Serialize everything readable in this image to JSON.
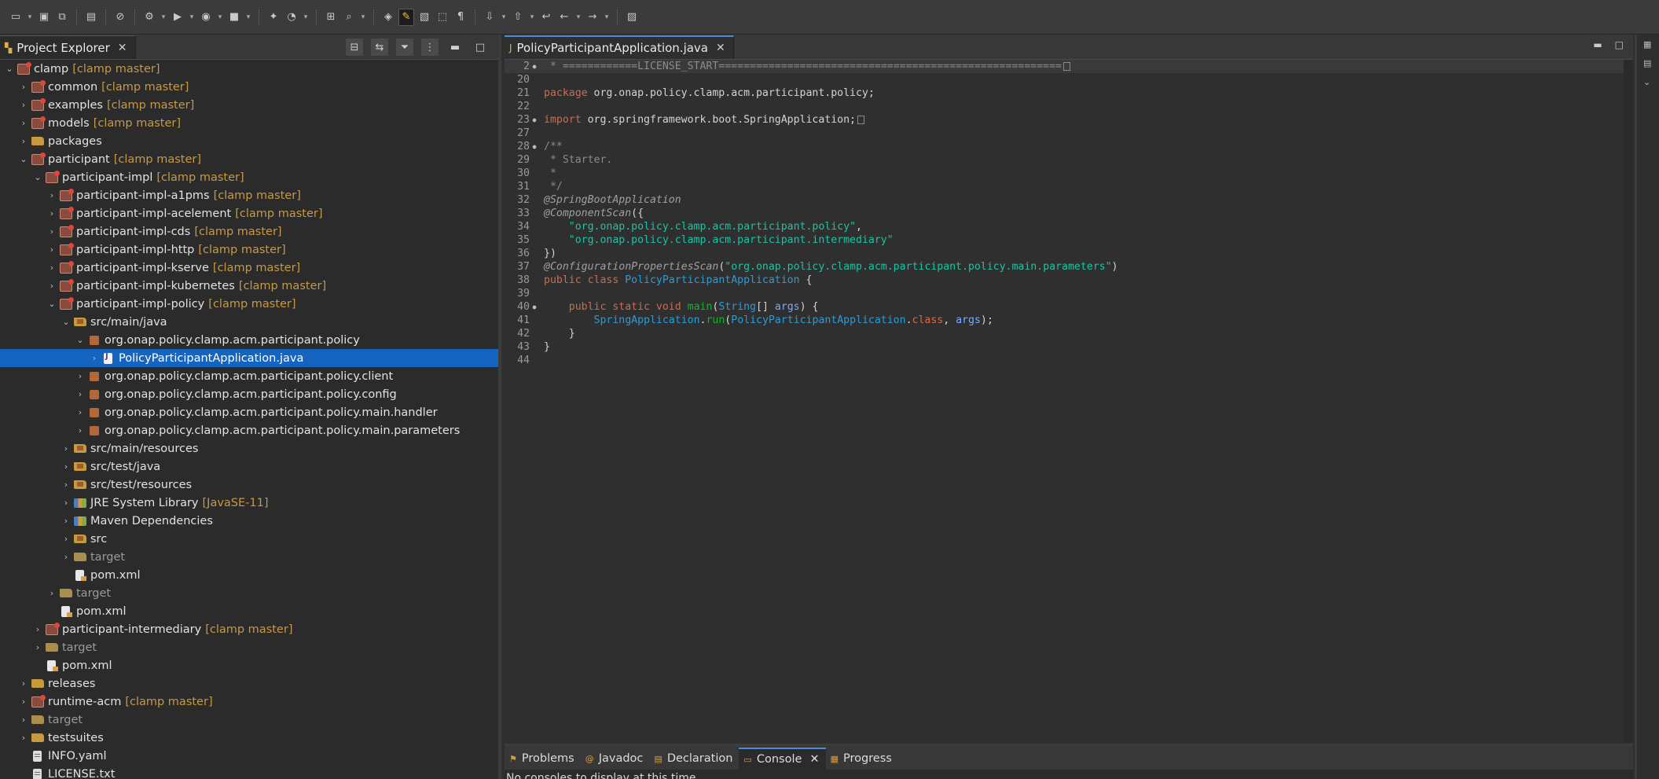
{
  "explorer": {
    "tab_label": "Project Explorer",
    "close_glyph": "✕",
    "tree": [
      {
        "indent": 0,
        "chev": "v",
        "icon": "project",
        "name": "clamp",
        "deco": "[clamp master]"
      },
      {
        "indent": 1,
        "chev": ">",
        "icon": "project",
        "name": "common",
        "deco": "[clamp master]"
      },
      {
        "indent": 1,
        "chev": ">",
        "icon": "project",
        "name": "examples",
        "deco": "[clamp master]"
      },
      {
        "indent": 1,
        "chev": ">",
        "icon": "project",
        "name": "models",
        "deco": "[clamp master]"
      },
      {
        "indent": 1,
        "chev": ">",
        "icon": "folder",
        "name": "packages",
        "deco": ""
      },
      {
        "indent": 1,
        "chev": "v",
        "icon": "project",
        "name": "participant",
        "deco": "[clamp master]"
      },
      {
        "indent": 2,
        "chev": "v",
        "icon": "project",
        "name": "participant-impl",
        "deco": "[clamp master]"
      },
      {
        "indent": 3,
        "chev": ">",
        "icon": "project",
        "name": "participant-impl-a1pms",
        "deco": "[clamp master]"
      },
      {
        "indent": 3,
        "chev": ">",
        "icon": "project",
        "name": "participant-impl-acelement",
        "deco": "[clamp master]"
      },
      {
        "indent": 3,
        "chev": ">",
        "icon": "project",
        "name": "participant-impl-cds",
        "deco": "[clamp master]"
      },
      {
        "indent": 3,
        "chev": ">",
        "icon": "project",
        "name": "participant-impl-http",
        "deco": "[clamp master]"
      },
      {
        "indent": 3,
        "chev": ">",
        "icon": "project",
        "name": "participant-impl-kserve",
        "deco": "[clamp master]"
      },
      {
        "indent": 3,
        "chev": ">",
        "icon": "project",
        "name": "participant-impl-kubernetes",
        "deco": "[clamp master]"
      },
      {
        "indent": 3,
        "chev": "v",
        "icon": "project",
        "name": "participant-impl-policy",
        "deco": "[clamp master]"
      },
      {
        "indent": 4,
        "chev": "v",
        "icon": "folder-src",
        "name": "src/main/java",
        "deco": ""
      },
      {
        "indent": 5,
        "chev": "v",
        "icon": "package",
        "name": "org.onap.policy.clamp.acm.participant.policy",
        "deco": ""
      },
      {
        "indent": 6,
        "chev": ">",
        "icon": "java",
        "name": "PolicyParticipantApplication.java",
        "deco": "",
        "selected": true
      },
      {
        "indent": 5,
        "chev": ">",
        "icon": "package",
        "name": "org.onap.policy.clamp.acm.participant.policy.client",
        "deco": ""
      },
      {
        "indent": 5,
        "chev": ">",
        "icon": "package",
        "name": "org.onap.policy.clamp.acm.participant.policy.config",
        "deco": ""
      },
      {
        "indent": 5,
        "chev": ">",
        "icon": "package",
        "name": "org.onap.policy.clamp.acm.participant.policy.main.handler",
        "deco": ""
      },
      {
        "indent": 5,
        "chev": ">",
        "icon": "package",
        "name": "org.onap.policy.clamp.acm.participant.policy.main.parameters",
        "deco": ""
      },
      {
        "indent": 4,
        "chev": ">",
        "icon": "folder-src",
        "name": "src/main/resources",
        "deco": ""
      },
      {
        "indent": 4,
        "chev": ">",
        "icon": "folder-src",
        "name": "src/test/java",
        "deco": ""
      },
      {
        "indent": 4,
        "chev": ">",
        "icon": "folder-src",
        "name": "src/test/resources",
        "deco": ""
      },
      {
        "indent": 4,
        "chev": ">",
        "icon": "lib",
        "name": "JRE System Library",
        "deco": "[JavaSE-11]"
      },
      {
        "indent": 4,
        "chev": ">",
        "icon": "lib",
        "name": "Maven Dependencies",
        "deco": ""
      },
      {
        "indent": 4,
        "chev": ">",
        "icon": "folder-src",
        "name": "src",
        "deco": ""
      },
      {
        "indent": 4,
        "chev": ">",
        "icon": "folder-target",
        "name": "target",
        "deco": "",
        "muted": true
      },
      {
        "indent": 4,
        "chev": "",
        "icon": "xml",
        "name": "pom.xml",
        "deco": ""
      },
      {
        "indent": 3,
        "chev": ">",
        "icon": "folder-target",
        "name": "target",
        "deco": "",
        "muted": true
      },
      {
        "indent": 3,
        "chev": "",
        "icon": "xml",
        "name": "pom.xml",
        "deco": ""
      },
      {
        "indent": 2,
        "chev": ">",
        "icon": "project",
        "name": "participant-intermediary",
        "deco": "[clamp master]"
      },
      {
        "indent": 2,
        "chev": ">",
        "icon": "folder-target",
        "name": "target",
        "deco": "",
        "muted": true
      },
      {
        "indent": 2,
        "chev": "",
        "icon": "xml",
        "name": "pom.xml",
        "deco": ""
      },
      {
        "indent": 1,
        "chev": ">",
        "icon": "folder",
        "name": "releases",
        "deco": ""
      },
      {
        "indent": 1,
        "chev": ">",
        "icon": "project",
        "name": "runtime-acm",
        "deco": "[clamp master]"
      },
      {
        "indent": 1,
        "chev": ">",
        "icon": "folder-target",
        "name": "target",
        "deco": "",
        "muted": true
      },
      {
        "indent": 1,
        "chev": ">",
        "icon": "folder",
        "name": "testsuites",
        "deco": ""
      },
      {
        "indent": 1,
        "chev": "",
        "icon": "file",
        "name": "INFO.yaml",
        "deco": ""
      },
      {
        "indent": 1,
        "chev": "",
        "icon": "file",
        "name": "LICENSE.txt",
        "deco": ""
      }
    ]
  },
  "editor": {
    "tab_label": "PolicyParticipantApplication.java",
    "close_glyph": "✕",
    "lines": [
      {
        "n": "2",
        "fold": "+",
        "first": true,
        "parts": [
          [
            "cmt",
            " * ============LICENSE_START======================================================="
          ],
          [
            "box",
            ""
          ]
        ]
      },
      {
        "n": "20",
        "parts": []
      },
      {
        "n": "21",
        "parts": [
          [
            "kw",
            "package"
          ],
          [
            "tx",
            " org.onap.policy.clamp.acm.participant.policy;"
          ]
        ]
      },
      {
        "n": "22",
        "parts": []
      },
      {
        "n": "23",
        "fold": "+",
        "parts": [
          [
            "kw",
            "import"
          ],
          [
            "tx",
            " org.springframework.boot.SpringApplication;"
          ],
          [
            "box",
            ""
          ]
        ]
      },
      {
        "n": "27",
        "parts": []
      },
      {
        "n": "28",
        "fold": "-",
        "parts": [
          [
            "cmt",
            "/**"
          ]
        ]
      },
      {
        "n": "29",
        "parts": [
          [
            "cmt",
            " * Starter."
          ]
        ]
      },
      {
        "n": "30",
        "parts": [
          [
            "cmt",
            " *"
          ]
        ]
      },
      {
        "n": "31",
        "parts": [
          [
            "cmt",
            " */"
          ]
        ]
      },
      {
        "n": "32",
        "parts": [
          [
            "ann",
            "@SpringBootApplication"
          ]
        ]
      },
      {
        "n": "33",
        "parts": [
          [
            "ann",
            "@ComponentScan"
          ],
          [
            "tx",
            "({"
          ]
        ]
      },
      {
        "n": "34",
        "parts": [
          [
            "tx",
            "    "
          ],
          [
            "str",
            "\"org.onap.policy.clamp.acm.participant.policy\""
          ],
          [
            "tx",
            ","
          ]
        ]
      },
      {
        "n": "35",
        "parts": [
          [
            "tx",
            "    "
          ],
          [
            "str",
            "\"org.onap.policy.clamp.acm.participant.intermediary\""
          ]
        ]
      },
      {
        "n": "36",
        "parts": [
          [
            "tx",
            "})"
          ]
        ]
      },
      {
        "n": "37",
        "parts": [
          [
            "ann",
            "@ConfigurationPropertiesScan"
          ],
          [
            "tx",
            "("
          ],
          [
            "str",
            "\"org.onap.policy.clamp.acm.participant.policy.main.parameters\""
          ],
          [
            "tx",
            ")"
          ]
        ]
      },
      {
        "n": "38",
        "parts": [
          [
            "kw",
            "public class"
          ],
          [
            "tx",
            " "
          ],
          [
            "cls",
            "PolicyParticipantApplication"
          ],
          [
            "tx",
            " {"
          ]
        ]
      },
      {
        "n": "39",
        "parts": []
      },
      {
        "n": "40",
        "fold": "-",
        "parts": [
          [
            "tx",
            "    "
          ],
          [
            "kw",
            "public static void"
          ],
          [
            "tx",
            " "
          ],
          [
            "mth",
            "main"
          ],
          [
            "tx",
            "("
          ],
          [
            "cls",
            "String"
          ],
          [
            "tx",
            "[] "
          ],
          [
            "var",
            "args"
          ],
          [
            "tx",
            ") {"
          ]
        ]
      },
      {
        "n": "41",
        "parts": [
          [
            "tx",
            "        "
          ],
          [
            "cls",
            "SpringApplication"
          ],
          [
            "tx",
            "."
          ],
          [
            "mth",
            "run"
          ],
          [
            "tx",
            "("
          ],
          [
            "cls",
            "PolicyParticipantApplication"
          ],
          [
            "tx",
            "."
          ],
          [
            "kw",
            "class"
          ],
          [
            "tx",
            ", "
          ],
          [
            "var",
            "args"
          ],
          [
            "tx",
            ");"
          ]
        ]
      },
      {
        "n": "42",
        "parts": [
          [
            "tx",
            "    }"
          ]
        ]
      },
      {
        "n": "43",
        "parts": [
          [
            "tx",
            "}"
          ]
        ]
      },
      {
        "n": "44",
        "parts": []
      }
    ]
  },
  "bottom": {
    "tabs": [
      {
        "label": "Problems",
        "icon": "problems-icon",
        "active": false
      },
      {
        "label": "Javadoc",
        "icon": "javadoc-icon",
        "active": false
      },
      {
        "label": "Declaration",
        "icon": "declaration-icon",
        "active": false
      },
      {
        "label": "Console",
        "icon": "console-icon",
        "active": true
      },
      {
        "label": "Progress",
        "icon": "progress-icon",
        "active": false
      }
    ],
    "console_message": "No consoles to display at this time."
  }
}
